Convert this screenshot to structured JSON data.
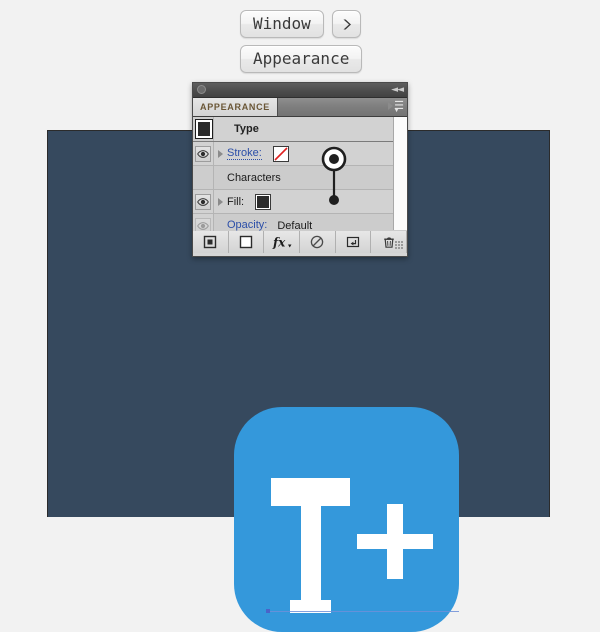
{
  "menu_path": {
    "steps": [
      {
        "label": "Window",
        "name": "window-menu-button"
      },
      {
        "label": "Appearance",
        "name": "appearance-menu-item"
      }
    ],
    "arrow_icon": "chevron-right-icon"
  },
  "panel": {
    "titlebar": {
      "dot_icon": "panel-handle-dot-icon",
      "collapse_icon": "collapse-double-arrow-icon"
    },
    "tab_label": "APPEARANCE",
    "menu_icon": "panel-flyout-menu-icon",
    "rows": [
      {
        "id": "type",
        "label": "Type",
        "visibility_icon": null,
        "swatch": "dark",
        "kind": "header"
      },
      {
        "id": "stroke",
        "label": "Stroke:",
        "visibility_icon": "eye-icon",
        "swatch": "none",
        "kind": "attribute",
        "disclosure": true
      },
      {
        "id": "characters",
        "label": "Characters",
        "visibility_icon": null,
        "swatch": null,
        "kind": "sub"
      },
      {
        "id": "fill",
        "label": "Fill:",
        "visibility_icon": "eye-icon",
        "swatch": "dark",
        "kind": "attribute",
        "disclosure": true
      },
      {
        "id": "opacity",
        "label": "Opacity:",
        "value": "Default",
        "visibility_icon": "eye-icon-dimmed",
        "swatch": null,
        "kind": "attribute"
      }
    ],
    "footer_buttons": [
      {
        "name": "add-new-stroke-button",
        "icon": "filled-square-icon"
      },
      {
        "name": "add-new-fill-button",
        "icon": "empty-square-icon"
      },
      {
        "name": "add-new-effect-button",
        "icon": "fx-icon"
      },
      {
        "name": "clear-appearance-button",
        "icon": "no-symbol-icon"
      },
      {
        "name": "duplicate-item-button",
        "icon": "duplicate-icon"
      },
      {
        "name": "delete-item-button",
        "icon": "trash-icon"
      }
    ],
    "resize_grip_icon": "resize-grip-icon",
    "scrollbar_name": "panel-vertical-scrollbar"
  },
  "annotation": {
    "pin_icon": "pointer-pin-icon"
  },
  "artboard": {
    "background_color": "#36495e",
    "icon": {
      "name": "app-icon-artwork",
      "background_color": "#3498db",
      "glyph_color": "#ffffff",
      "glyphs": [
        "T",
        "+"
      ],
      "baseline_color": "#6f8fd8",
      "anchor_color": "#4a63c8"
    }
  }
}
